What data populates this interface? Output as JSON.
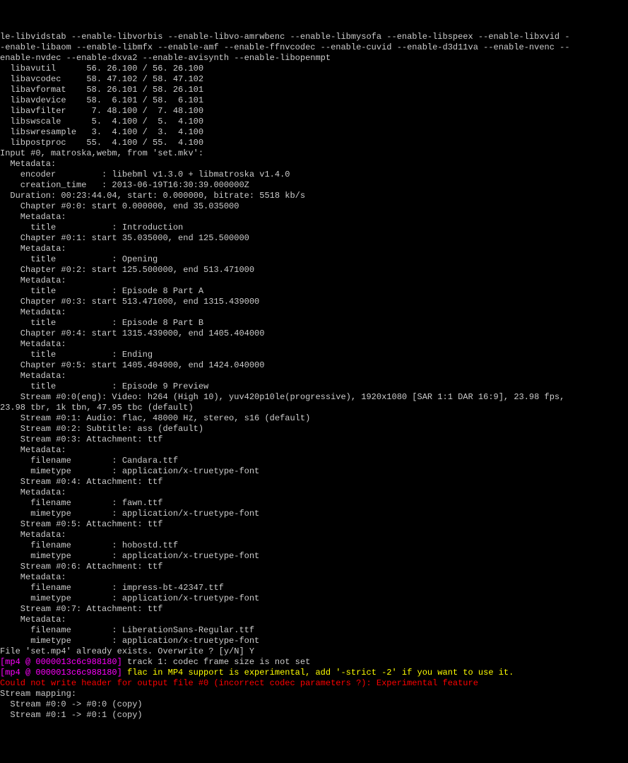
{
  "lines": [
    {
      "text": "le-libvidstab --enable-libvorbis --enable-libvo-amrwbenc --enable-libmysofa --enable-libspeex --enable-libxvid -",
      "class": "white"
    },
    {
      "text": "-enable-libaom --enable-libmfx --enable-amf --enable-ffnvcodec --enable-cuvid --enable-d3d11va --enable-nvenc --",
      "class": "white"
    },
    {
      "text": "enable-nvdec --enable-dxva2 --enable-avisynth --enable-libopenmpt",
      "class": "white"
    },
    {
      "text": "  libavutil      56. 26.100 / 56. 26.100",
      "class": "white"
    },
    {
      "text": "  libavcodec     58. 47.102 / 58. 47.102",
      "class": "white"
    },
    {
      "text": "  libavformat    58. 26.101 / 58. 26.101",
      "class": "white"
    },
    {
      "text": "  libavdevice    58.  6.101 / 58.  6.101",
      "class": "white"
    },
    {
      "text": "  libavfilter     7. 48.100 /  7. 48.100",
      "class": "white"
    },
    {
      "text": "  libswscale      5.  4.100 /  5.  4.100",
      "class": "white"
    },
    {
      "text": "  libswresample   3.  4.100 /  3.  4.100",
      "class": "white"
    },
    {
      "text": "  libpostproc    55.  4.100 / 55.  4.100",
      "class": "white"
    },
    {
      "text": "Input #0, matroska,webm, from 'set.mkv':",
      "class": "white"
    },
    {
      "text": "  Metadata:",
      "class": "white"
    },
    {
      "text": "    encoder         : libebml v1.3.0 + libmatroska v1.4.0",
      "class": "white"
    },
    {
      "text": "    creation_time   : 2013-06-19T16:30:39.000000Z",
      "class": "white"
    },
    {
      "text": "  Duration: 00:23:44.04, start: 0.000000, bitrate: 5518 kb/s",
      "class": "white"
    },
    {
      "text": "    Chapter #0:0: start 0.000000, end 35.035000",
      "class": "white"
    },
    {
      "text": "    Metadata:",
      "class": "white"
    },
    {
      "text": "      title           : Introduction",
      "class": "white"
    },
    {
      "text": "    Chapter #0:1: start 35.035000, end 125.500000",
      "class": "white"
    },
    {
      "text": "    Metadata:",
      "class": "white"
    },
    {
      "text": "      title           : Opening",
      "class": "white"
    },
    {
      "text": "    Chapter #0:2: start 125.500000, end 513.471000",
      "class": "white"
    },
    {
      "text": "    Metadata:",
      "class": "white"
    },
    {
      "text": "      title           : Episode 8 Part A",
      "class": "white"
    },
    {
      "text": "    Chapter #0:3: start 513.471000, end 1315.439000",
      "class": "white"
    },
    {
      "text": "    Metadata:",
      "class": "white"
    },
    {
      "text": "      title           : Episode 8 Part B",
      "class": "white"
    },
    {
      "text": "    Chapter #0:4: start 1315.439000, end 1405.404000",
      "class": "white"
    },
    {
      "text": "    Metadata:",
      "class": "white"
    },
    {
      "text": "      title           : Ending",
      "class": "white"
    },
    {
      "text": "    Chapter #0:5: start 1405.404000, end 1424.040000",
      "class": "white"
    },
    {
      "text": "    Metadata:",
      "class": "white"
    },
    {
      "text": "      title           : Episode 9 Preview",
      "class": "white"
    },
    {
      "text": "    Stream #0:0(eng): Video: h264 (High 10), yuv420p10le(progressive), 1920x1080 [SAR 1:1 DAR 16:9], 23.98 fps,",
      "class": "white"
    },
    {
      "text": "23.98 tbr, 1k tbn, 47.95 tbc (default)",
      "class": "white"
    },
    {
      "text": "    Stream #0:1: Audio: flac, 48000 Hz, stereo, s16 (default)",
      "class": "white"
    },
    {
      "text": "    Stream #0:2: Subtitle: ass (default)",
      "class": "white"
    },
    {
      "text": "    Stream #0:3: Attachment: ttf",
      "class": "white"
    },
    {
      "text": "    Metadata:",
      "class": "white"
    },
    {
      "text": "      filename        : Candara.ttf",
      "class": "white"
    },
    {
      "text": "      mimetype        : application/x-truetype-font",
      "class": "white"
    },
    {
      "text": "    Stream #0:4: Attachment: ttf",
      "class": "white"
    },
    {
      "text": "    Metadata:",
      "class": "white"
    },
    {
      "text": "      filename        : fawn.ttf",
      "class": "white"
    },
    {
      "text": "      mimetype        : application/x-truetype-font",
      "class": "white"
    },
    {
      "text": "    Stream #0:5: Attachment: ttf",
      "class": "white"
    },
    {
      "text": "    Metadata:",
      "class": "white"
    },
    {
      "text": "      filename        : hobostd.ttf",
      "class": "white"
    },
    {
      "text": "      mimetype        : application/x-truetype-font",
      "class": "white"
    },
    {
      "text": "    Stream #0:6: Attachment: ttf",
      "class": "white"
    },
    {
      "text": "    Metadata:",
      "class": "white"
    },
    {
      "text": "      filename        : impress-bt-42347.ttf",
      "class": "white"
    },
    {
      "text": "      mimetype        : application/x-truetype-font",
      "class": "white"
    },
    {
      "text": "    Stream #0:7: Attachment: ttf",
      "class": "white"
    },
    {
      "text": "    Metadata:",
      "class": "white"
    },
    {
      "text": "      filename        : LiberationSans-Regular.ttf",
      "class": "white"
    },
    {
      "text": "      mimetype        : application/x-truetype-font",
      "class": "white"
    },
    {
      "text": "File 'set.mp4' already exists. Overwrite ? [y/N] Y",
      "class": "white"
    }
  ],
  "mp4_lines": [
    {
      "prefix": "[mp4 @ 0000013c6c988180] ",
      "msg": "track 1: codec frame size is not set",
      "msgclass": "white"
    },
    {
      "prefix": "[mp4 @ 0000013c6c988180] ",
      "msg": "flac in MP4 support is experimental, add '-strict -2' if you want to use it.",
      "msgclass": "yellow"
    }
  ],
  "error_line": "Could not write header for output file #0 (incorrect codec parameters ?): Experimental feature",
  "tail_lines": [
    "Stream mapping:",
    "  Stream #0:0 -> #0:0 (copy)",
    "  Stream #0:1 -> #0:1 (copy)"
  ]
}
